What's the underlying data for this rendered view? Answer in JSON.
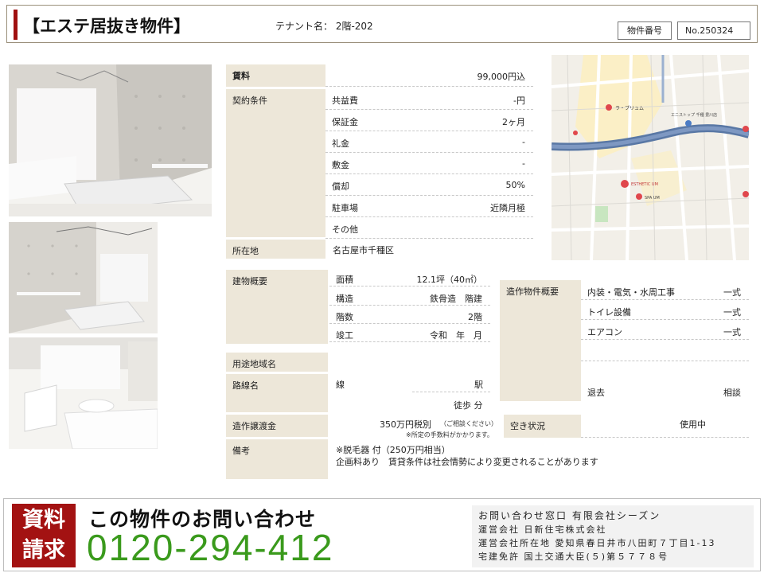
{
  "header": {
    "title": "【エステ居抜き物件】",
    "tenant": "テナント名： 2階-202",
    "property_no_label": "物件番号",
    "property_no": "No.250324"
  },
  "rent": {
    "label": "賃料",
    "value": "99,000円込"
  },
  "contract": {
    "label": "契約条件",
    "rows": [
      {
        "key": "共益費",
        "value": "-円"
      },
      {
        "key": "保証金",
        "value": "2ヶ月"
      },
      {
        "key": "礼金",
        "value": "-"
      },
      {
        "key": "敷金",
        "value": "-"
      },
      {
        "key": "償却",
        "value": "50%"
      },
      {
        "key": "駐車場",
        "value": "近隣月極"
      },
      {
        "key": "その他",
        "value": ""
      }
    ]
  },
  "location": {
    "label": "所在地",
    "value": "名古屋市千種区"
  },
  "building": {
    "label": "建物概要",
    "rows": [
      {
        "key": "面積",
        "value": "12.1坪（40㎡）"
      },
      {
        "key": "構造",
        "value": "鉄骨造　階建"
      },
      {
        "key": "階数",
        "value": "2階"
      },
      {
        "key": "竣工",
        "value": "令和　年　月"
      }
    ]
  },
  "fixtures": {
    "label": "造作物件概要",
    "rows": [
      {
        "key": "内装・電気・水周工事",
        "value": "一式"
      },
      {
        "key": "トイレ設備",
        "value": "一式"
      },
      {
        "key": "エアコン",
        "value": "一式"
      },
      {
        "key": "",
        "value": ""
      },
      {
        "key": "退去",
        "value": "相談"
      }
    ]
  },
  "zoning": {
    "label": "用途地域名"
  },
  "route": {
    "label": "路線名",
    "line": "線",
    "station": "駅",
    "walk": "徒歩 分"
  },
  "transfer": {
    "label": "造作譲渡金",
    "value": "350万円税別",
    "note1": "（ご相談ください）",
    "note2": "※所定の手数料がかかります。"
  },
  "vacancy": {
    "label": "空き状況",
    "value": "使用中"
  },
  "remarks": {
    "label": "備考",
    "line1": "※脱毛器 付（250万円相当）",
    "line2": "企画料あり　賃貸条件は社会情勢により変更されることがあります"
  },
  "map": {
    "poi1": "ラ・プリュム",
    "poi2": "エニストップ 千種 豊川店",
    "poi3": "ESTHETIC UM",
    "poi4": "SPA UM"
  },
  "footer": {
    "request_line1": "資料",
    "request_line2": "請求",
    "inquiry": "この物件のお問い合わせ",
    "phone": "0120-294-412",
    "info_title": "お問い合わせ窓口 有限会社シーズン",
    "info_line1": "運営会社 日新住宅株式会社",
    "info_line2": "運営会社所在地 愛知県春日井市八田町７丁目1-13",
    "info_line3": "宅建免許 国土交通大臣(５)第５７７８号"
  },
  "colors": {
    "accent": "#a01010",
    "label_bg": "#ede7d9",
    "phone": "#3a9a1c"
  }
}
